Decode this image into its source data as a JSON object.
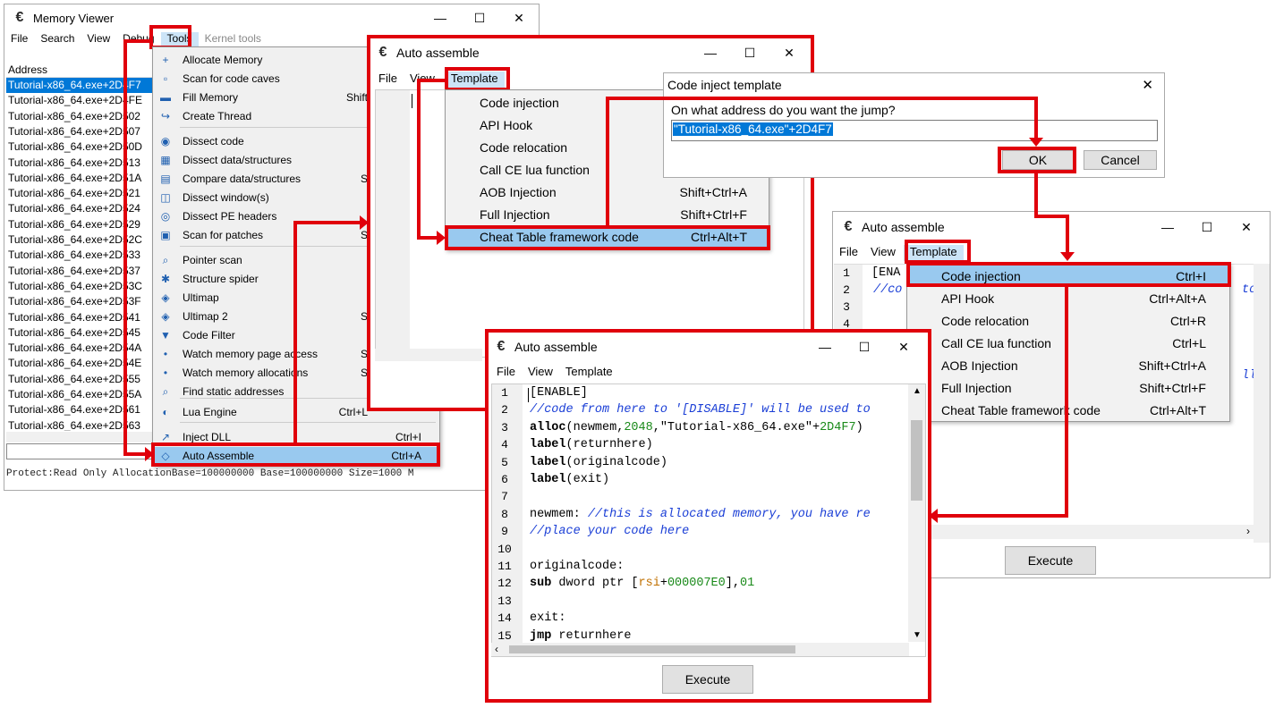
{
  "memory_viewer": {
    "title": "Memory Viewer",
    "menu": [
      "File",
      "Search",
      "View",
      "Debug",
      "Tools",
      "Kernel tools"
    ],
    "address_header": "Address",
    "addresses": [
      "Tutorial-x86_64.exe+2D4F7",
      "Tutorial-x86_64.exe+2D4FE",
      "Tutorial-x86_64.exe+2D502",
      "Tutorial-x86_64.exe+2D507",
      "Tutorial-x86_64.exe+2D50D",
      "Tutorial-x86_64.exe+2D513",
      "Tutorial-x86_64.exe+2D51A",
      "Tutorial-x86_64.exe+2D521",
      "Tutorial-x86_64.exe+2D524",
      "Tutorial-x86_64.exe+2D529",
      "Tutorial-x86_64.exe+2D52C",
      "Tutorial-x86_64.exe+2D533",
      "Tutorial-x86_64.exe+2D537",
      "Tutorial-x86_64.exe+2D53C",
      "Tutorial-x86_64.exe+2D53F",
      "Tutorial-x86_64.exe+2D541",
      "Tutorial-x86_64.exe+2D545",
      "Tutorial-x86_64.exe+2D54A",
      "Tutorial-x86_64.exe+2D54E",
      "Tutorial-x86_64.exe+2D555",
      "Tutorial-x86_64.exe+2D55A",
      "Tutorial-x86_64.exe+2D561",
      "Tutorial-x86_64.exe+2D563"
    ],
    "status": "Protect:Read Only  AllocationBase=100000000 Base=100000000 Size=1000 M"
  },
  "tools_menu": [
    {
      "label": "Allocate Memory",
      "shortcut": "",
      "icon": "plus-icon"
    },
    {
      "label": "Scan for code caves",
      "shortcut": "",
      "icon": "null-icon"
    },
    {
      "label": "Fill Memory",
      "shortcut": "Shift",
      "icon": "fill-icon"
    },
    {
      "label": "Create Thread",
      "shortcut": "",
      "icon": "thread-icon"
    },
    {
      "label": "Dissect code",
      "shortcut": "",
      "icon": "eye-icon"
    },
    {
      "label": "Dissect data/structures",
      "shortcut": "",
      "icon": "structure-icon"
    },
    {
      "label": "Compare data/structures",
      "shortcut": "S",
      "icon": "compare-icon"
    },
    {
      "label": "Dissect window(s)",
      "shortcut": "",
      "icon": "window-icon"
    },
    {
      "label": "Dissect PE headers",
      "shortcut": "",
      "icon": "pe-icon"
    },
    {
      "label": "Scan for patches",
      "shortcut": "S",
      "icon": "patch-icon"
    },
    {
      "label": "Pointer scan",
      "shortcut": "",
      "icon": "magnifier-icon"
    },
    {
      "label": "Structure spider",
      "shortcut": "",
      "icon": "spider-icon"
    },
    {
      "label": "Ultimap",
      "shortcut": "",
      "icon": "ultimap-icon"
    },
    {
      "label": "Ultimap 2",
      "shortcut": "S",
      "icon": "ultimap-icon"
    },
    {
      "label": "Code Filter",
      "shortcut": "",
      "icon": "filter-icon"
    },
    {
      "label": "Watch memory page access",
      "shortcut": "S",
      "icon": "dot-icon"
    },
    {
      "label": "Watch memory allocations",
      "shortcut": "S",
      "icon": "dot-icon"
    },
    {
      "label": "Find static addresses",
      "shortcut": "",
      "icon": "find-icon"
    },
    {
      "label": "Lua Engine",
      "shortcut": "Ctrl+L",
      "icon": "lua-icon"
    },
    {
      "label": "Inject DLL",
      "shortcut": "Ctrl+I",
      "icon": "syringe-icon"
    },
    {
      "label": "Auto Assemble",
      "shortcut": "Ctrl+A",
      "icon": "assemble-icon"
    }
  ],
  "aa1": {
    "title": "Auto assemble",
    "menu": [
      "File",
      "View",
      "Template"
    ],
    "template_menu": [
      {
        "label": "Code injection",
        "shortcut": ""
      },
      {
        "label": "API Hook",
        "shortcut": ""
      },
      {
        "label": "Code relocation",
        "shortcut": ""
      },
      {
        "label": "Call CE lua function",
        "shortcut": ""
      },
      {
        "label": "AOB Injection",
        "shortcut": "Shift+Ctrl+A"
      },
      {
        "label": "Full Injection",
        "shortcut": "Shift+Ctrl+F"
      },
      {
        "label": "Cheat Table framework code",
        "shortcut": "Ctrl+Alt+T"
      }
    ]
  },
  "inject_dialog": {
    "title": "Code inject template",
    "prompt": "On what address do you want the jump?",
    "value": "\"Tutorial-x86_64.exe\"+2D4F7",
    "ok": "OK",
    "cancel": "Cancel"
  },
  "aa2": {
    "title": "Auto assemble",
    "menu": [
      "File",
      "View",
      "Template"
    ],
    "template_menu": [
      {
        "label": "Code injection",
        "shortcut": "Ctrl+I"
      },
      {
        "label": "API Hook",
        "shortcut": "Ctrl+Alt+A"
      },
      {
        "label": "Code relocation",
        "shortcut": "Ctrl+R"
      },
      {
        "label": "Call CE lua function",
        "shortcut": "Ctrl+L"
      },
      {
        "label": "AOB Injection",
        "shortcut": "Shift+Ctrl+A"
      },
      {
        "label": "Full Injection",
        "shortcut": "Shift+Ctrl+F"
      },
      {
        "label": "Cheat Table framework code",
        "shortcut": "Ctrl+Alt+T"
      }
    ],
    "line_numbers": [
      "1",
      "2",
      "3",
      "4"
    ],
    "partial": [
      "[ENA",
      "//co"
    ],
    "right_frag_1": "to",
    "right_frag_2": "ll",
    "execute": "Execute"
  },
  "aa3": {
    "title": "Auto assemble",
    "menu": [
      "File",
      "View",
      "Template"
    ],
    "code_lines": [
      "[ENABLE]",
      "//code from here to '[DISABLE]' will be used to",
      "alloc(newmem,2048,\"Tutorial-x86_64.exe\"+2D4F7)",
      "label(returnhere)",
      "label(originalcode)",
      "label(exit)",
      "",
      "newmem: //this is allocated memory, you have re",
      "//place your code here",
      "",
      "originalcode:",
      "sub dword ptr [rsi+000007E0],01",
      "",
      "exit:",
      "jmp returnhere"
    ],
    "execute": "Execute"
  },
  "colors": {
    "highlight": "#e0000b",
    "selection": "#99c9ef",
    "address_selected": "#0078d7"
  }
}
